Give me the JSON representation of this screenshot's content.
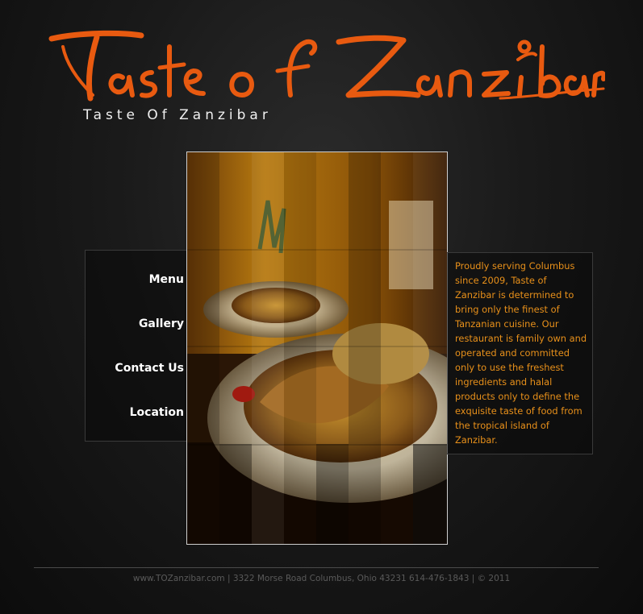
{
  "header": {
    "logo_text": "Taste of Zanzibar",
    "subtitle": "Taste Of Zanzibar",
    "logo_color": "#e85a10"
  },
  "nav": {
    "items": [
      {
        "label": "Menu"
      },
      {
        "label": "Gallery"
      },
      {
        "label": "Contact Us"
      },
      {
        "label": "Location"
      }
    ]
  },
  "description": {
    "text": "Proudly serving Columbus since 2009, Taste of Zanzibar is determined to bring only the finest of Tanzanian cuisine. Our restaurant is family own and operated and committed only to use the freshest ingredients and halal products only to define the exquisite taste of food from the tropical island of Zanzibar.",
    "color": "#e8901a"
  },
  "footer": {
    "text": "www.TOZanzibar.com | 3322 Morse Road Columbus, Ohio 43231 614-476-1843 | © 2011"
  }
}
